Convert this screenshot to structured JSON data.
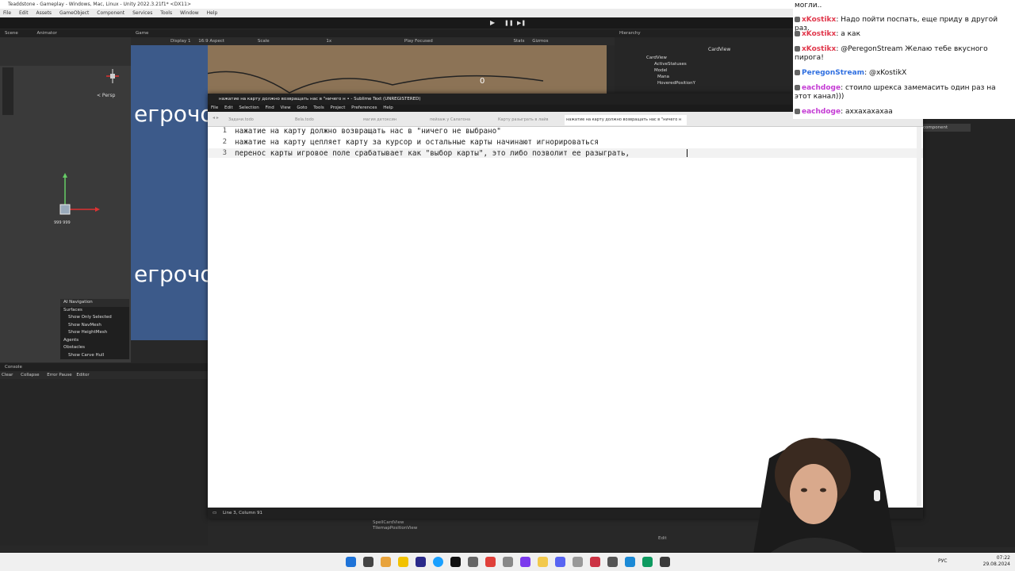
{
  "unity": {
    "title": "Teaddstone - Gameplay - Windows, Mac, Linux - Unity 2022.3.21f1* <DX11>",
    "menu": [
      "File",
      "Edit",
      "Assets",
      "GameObject",
      "Component",
      "Services",
      "Tools",
      "Window",
      "Help"
    ],
    "scene_tabs": [
      "Scene",
      "Animator"
    ],
    "game_tab": "Game",
    "game_toolbar": {
      "display": "Display 1",
      "aspect": "16:9 Aspect",
      "scale": "Scale",
      "scale_value": "1x",
      "play_focused": "Play Focused",
      "stats": "Stats",
      "gizmos": "Gizmos"
    },
    "game_counter": "0",
    "game_words": [
      "егрочо",
      "егрочо"
    ],
    "persp": "< Persp",
    "hierarchy_tab": "Hierarchy",
    "hierarchy_items": [
      "CardView",
      "ActiveStatuses",
      "Model",
      "Mana",
      "HoveredPositionY"
    ],
    "inspector_item": "CardView",
    "inspector_component": "component",
    "ai_navigation": {
      "title": "AI Navigation",
      "items": [
        "Surfaces",
        "Show Only Selected",
        "Show NavMesh",
        "Show HeightMesh",
        "Agents",
        "Obstacles",
        "Show Carve Hull"
      ]
    },
    "console_tab": "Console",
    "console_toolbar": [
      "Clear",
      "Collapse",
      "Error Pause",
      "Editor"
    ],
    "project_items": [
      "SpellCardView",
      "TilemapPositionView"
    ],
    "edit_label": "Edit"
  },
  "sublime": {
    "title": "нажатие на карту должно возвращать нас в \"ничего н • - Sublime Text (UNREGISTERED)",
    "menu": [
      "File",
      "Edit",
      "Selection",
      "Find",
      "View",
      "Goto",
      "Tools",
      "Project",
      "Preferences",
      "Help"
    ],
    "tabs": [
      {
        "label": "Задачи.todo",
        "active": false
      },
      {
        "label": "Bela.todo",
        "active": false
      },
      {
        "label": "магия детоксин",
        "active": false
      },
      {
        "label": "пейзаж у Салатона",
        "active": false
      },
      {
        "label": "Карту разыграть в лайв",
        "active": false
      },
      {
        "label": "нажатие на карту должно возвращать нас в \"ничего н",
        "active": true
      }
    ],
    "lines": [
      {
        "num": "1",
        "text": "нажатие на карту должно возвращать нас в \"ничего не выбрано\""
      },
      {
        "num": "2",
        "text": "нажатие на карту цепляет карту за курсор и остальные карты начинают игнорироваться"
      },
      {
        "num": "3",
        "text": "перенос карты игровое поле срабатывает как \"выбор карты\", это либо позволит ее разыграть, "
      }
    ],
    "status": "Line 3, Column 91"
  },
  "chat": {
    "header_fragment": "могли..",
    "messages": [
      {
        "user": "xKostikx",
        "color": "#e0364a",
        "text": "Надо пойти поспать, еще приду в другой раз."
      },
      {
        "user": "xKostikx",
        "color": "#e0364a",
        "text": "а как"
      },
      {
        "user": "xKostikx",
        "color": "#e0364a",
        "text": "@PeregonStream Желаю тебе вкусного пирога!"
      },
      {
        "user": "PeregonStream",
        "color": "#2f6fe0",
        "text": "@xKostikX"
      },
      {
        "user": "eachdoge",
        "color": "#c43bd4",
        "text": "стоило шрекса замемасить один раз на этот канал)))"
      },
      {
        "user": "eachdoge",
        "color": "#c43bd4",
        "text": "аххахахахаа"
      }
    ]
  },
  "taskbar": {
    "lang": "РУС",
    "time": "07:22",
    "date": "29.08.2024",
    "icon_colors": [
      "#1e73d8",
      "#444444",
      "#e8a33c",
      "#f2c200",
      "#2a2a8a",
      "#1aa0ff",
      "#111111",
      "#666666",
      "#e0403a",
      "#888888",
      "#7c3aed",
      "#f2c94c",
      "#5865f2",
      "#999999",
      "#cc3344",
      "#555555",
      "#1c8ad6",
      "#0e9a60",
      "#3a3a3a"
    ]
  },
  "colors": {
    "sublime_bg": "#ffffff",
    "unity_bg": "#282828",
    "chat_bg": "#ffffff"
  }
}
